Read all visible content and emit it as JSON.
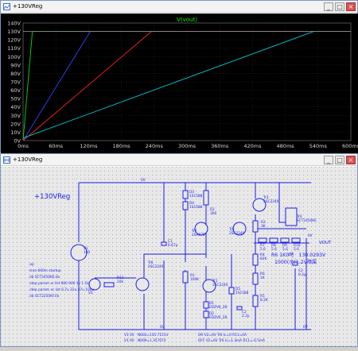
{
  "waveform_window": {
    "title": "+130VReg",
    "controls": {
      "minimize": "_",
      "maximize": "□",
      "close": "×"
    }
  },
  "chart_data": {
    "type": "line",
    "title": "V(vout)",
    "x_ticks": [
      "0ms",
      "60ms",
      "120ms",
      "180ms",
      "240ms",
      "300ms",
      "360ms",
      "420ms",
      "480ms",
      "540ms",
      "600ms"
    ],
    "y_ticks": [
      "0V",
      "10V",
      "20V",
      "30V",
      "40V",
      "50V",
      "60V",
      "70V",
      "80V",
      "90V",
      "100V",
      "110V",
      "120V",
      "130V",
      "140V"
    ],
    "xlim_ms": [
      0,
      600
    ],
    "ylim_v": [
      0,
      140
    ],
    "grid": true,
    "series": [
      {
        "color": "#00dd00",
        "points": [
          [
            0,
            0
          ],
          [
            17,
            130
          ],
          [
            600,
            130
          ]
        ]
      },
      {
        "color": "#3040ff",
        "points": [
          [
            0,
            0
          ],
          [
            123,
            130
          ],
          [
            600,
            130
          ]
        ]
      },
      {
        "color": "#ff2020",
        "points": [
          [
            0,
            0
          ],
          [
            235,
            130
          ],
          [
            600,
            130
          ]
        ]
      },
      {
        "color": "#00c8d0",
        "points": [
          [
            0,
            3
          ],
          [
            532,
            130
          ],
          [
            600,
            130
          ]
        ]
      },
      {
        "color": "#8a8a8a",
        "points": [
          [
            0,
            130
          ],
          [
            600,
            130
          ]
        ]
      }
    ]
  },
  "schematic_window": {
    "title": "+130VReg",
    "controls": {
      "minimize": "_",
      "maximize": "□",
      "close": "×"
    },
    "heading": "+130VReg",
    "labels": {
      "node_0v_top": "0V",
      "d3": "D3",
      "d3_part": "1S1588",
      "d4": "D4",
      "d4_part": "1S1588",
      "r2": "R2",
      "r2_val": "300",
      "tr3": "Tr3",
      "tr3_part": "2SC2240",
      "tr4": "Tr4",
      "tr4_part": "SCT2450KE",
      "tr5": "Tr5",
      "tr5_part": "2SC2240",
      "r3": "R3",
      "r3_val": "3K",
      "tr2": "Tr2",
      "tr2_part": "2SA970",
      "r7": "R7",
      "r7_val": "5.6",
      "r8": "R8",
      "r8_val": "5.6",
      "r9": "R9",
      "r9_val": "5.6",
      "r10": "R10",
      "r10_val": "5.6",
      "out_node": "0V",
      "vout": "VOUT",
      "r6_note": "R6 1K0時　130.0293V",
      "r6_note2": "1000(ボ)1.2V障属",
      "r4": "R4",
      "r4_val": "82K",
      "v1": "V1",
      "v1_val": "160",
      "c1": "C1",
      "c1_val": "6.67μ",
      "tr6": "Tr6",
      "tr6_part": "2SC2240",
      "r11": "R11",
      "r11_val": "10k",
      "v2": "V2",
      "r1": "R1",
      "r1_val": "100K",
      "tr1": "Tr1",
      "tr1_part": "2SC2240",
      "d5": "D5",
      "d5_part": "1S1588",
      "r5": "R5",
      "r5_val": "8.2K",
      "c2": "C2",
      "c2_val": "0.2μ",
      "r6": "R6",
      "r6_val": "1K",
      "d1": "D1",
      "d1_part": "EDZV6_2B",
      "d2": "D2",
      "d2_part": "EDZV6_2B",
      "c2b": "C2",
      "c2b_val": "2.2μ",
      "bottom_0v": "0V",
      "gnd_0v": "0V"
    },
    "directives": [
      ".op",
      ".tran 600m startup",
      ".lib SCT2450KE.lib",
      ".step param xr list 900 900 1k 1.1k",
      ".step param xc list 6.7u 22u 47u 100u",
      ".lib SCT2250KF.lib"
    ],
    "op_notes": [
      "V1 0V　N002=135.7151V",
      "V1 0V　N009=1.35707V",
      "OR V2=0V Tr6 Ic=0 R11=0A",
      "OFF V2=6V Tr6 Ic=1.3mA R11=-0.5mA"
    ]
  }
}
